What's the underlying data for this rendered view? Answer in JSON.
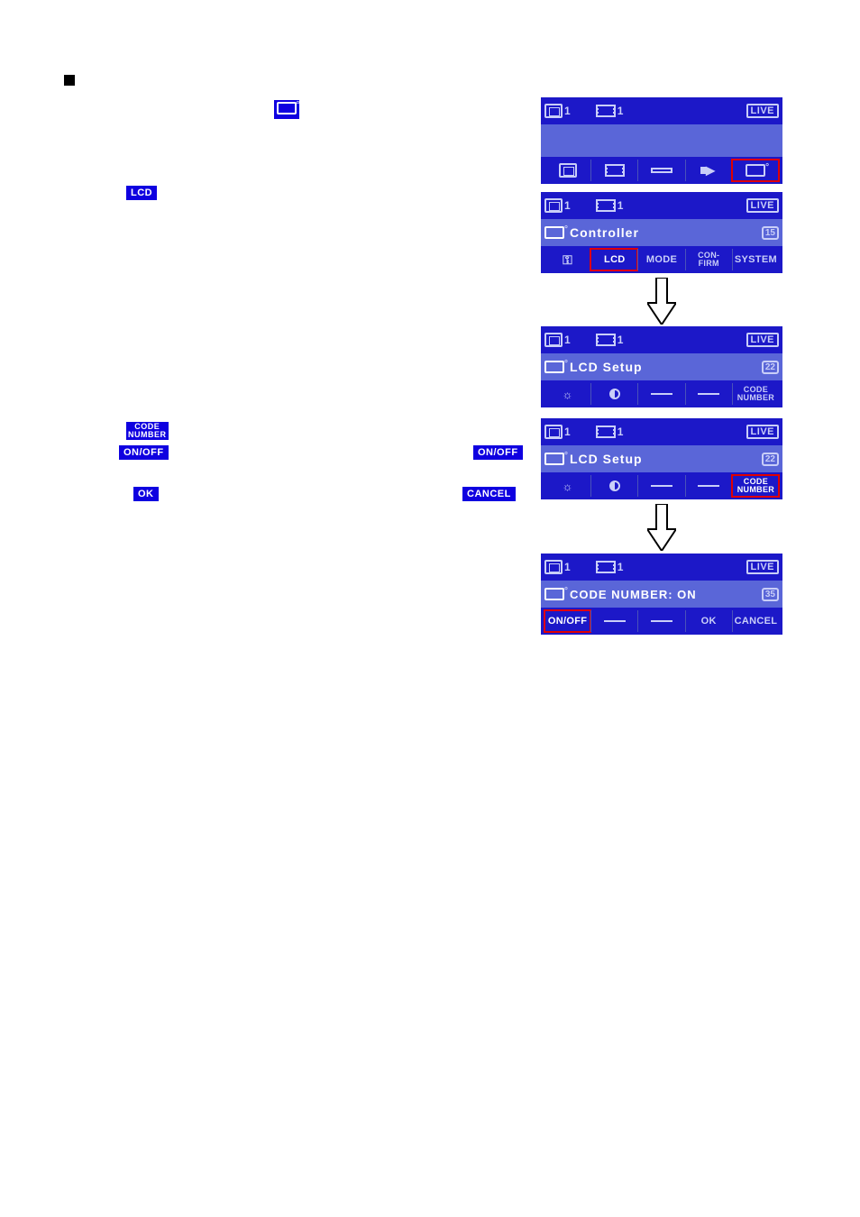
{
  "left_tags": {
    "controller_icon_alt": "controller-icon",
    "lcd": "LCD",
    "code_number_l1": "CODE",
    "code_number_l2": "NUMBER",
    "on_off": "ON/OFF",
    "ok": "OK",
    "cancel": "CANCEL"
  },
  "screens": {
    "s1": {
      "top_num1": "1",
      "top_num2": "1",
      "live": "LIVE",
      "btn_highlight": "controller"
    },
    "s2": {
      "top_num1": "1",
      "top_num2": "1",
      "live": "LIVE",
      "title": "Controller",
      "pagenum": "15",
      "buttons": [
        "key-icon",
        "LCD",
        "MODE",
        "CON-FIRM",
        "SYSTEM"
      ],
      "highlight": "LCD"
    },
    "s3": {
      "top_num1": "1",
      "top_num2": "1",
      "live": "LIVE",
      "title": "LCD Setup",
      "pagenum": "22",
      "code_l1": "CODE",
      "code_l2": "NUMBER"
    },
    "s4": {
      "top_num1": "1",
      "top_num2": "1",
      "live": "LIVE",
      "title": "LCD Setup",
      "pagenum": "22",
      "code_l1": "CODE",
      "code_l2": "NUMBER"
    },
    "s5": {
      "top_num1": "1",
      "top_num2": "1",
      "live": "LIVE",
      "title": "CODE NUMBER: ON",
      "pagenum": "35",
      "buttons": [
        "ON/OFF",
        "",
        "",
        "OK",
        "CANCEL"
      ]
    }
  }
}
